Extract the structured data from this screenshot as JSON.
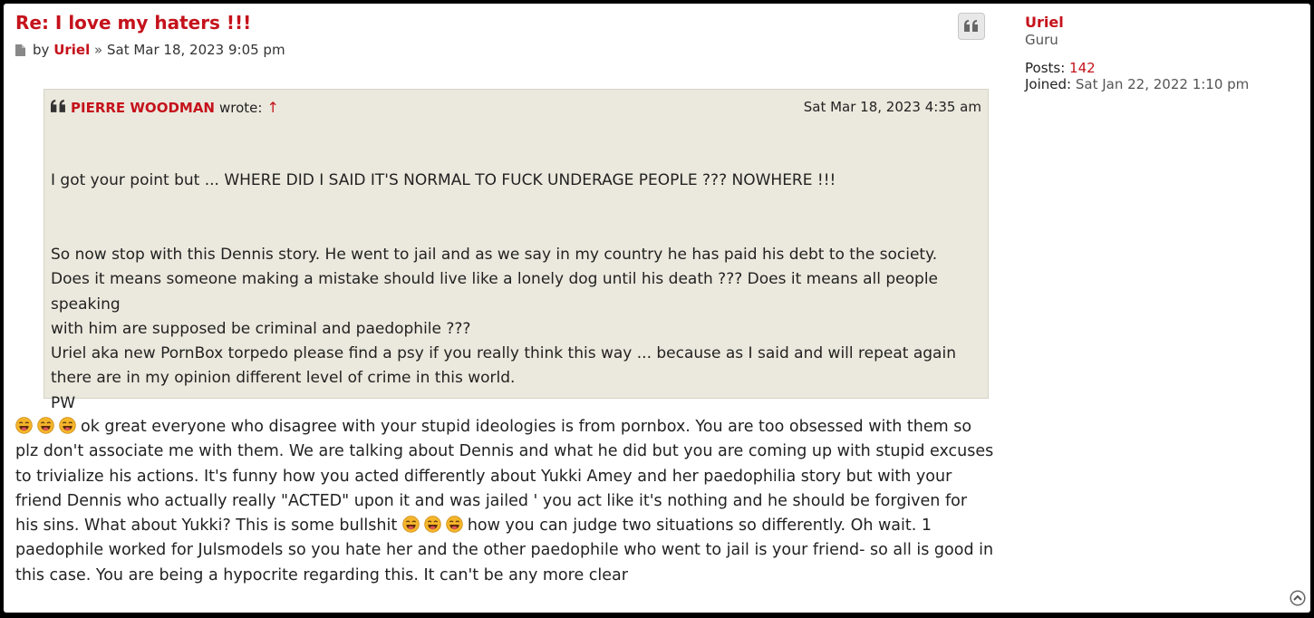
{
  "post": {
    "title": "Re: I love my haters !!!",
    "by_label": "by",
    "author": "Uriel",
    "separator": "»",
    "datetime": "Sat Mar 18, 2023 9:05 pm"
  },
  "quote": {
    "author": "PIERRE WOODMAN",
    "wrote_label": "wrote:",
    "arrow": "↑",
    "date": "Sat Mar 18, 2023 4:35 am",
    "lines": [
      "I got your point but ... WHERE DID I SAID IT'S NORMAL TO FUCK UNDERAGE PEOPLE ??? NOWHERE !!!",
      "So now stop with this Dennis story. He went to jail and as we say in my country he has paid his debt to the society.",
      "Does it means someone making a mistake should live like a lonely dog until his death ??? Does it means all people speaking",
      "with him are supposed be criminal and paedophile ???",
      "Uriel aka new PornBox torpedo please find a psy if you really think this way ... because as I said and will repeat again",
      "there are in my opinion different level of crime in this world.",
      "PW"
    ]
  },
  "body": {
    "part1": "ok great everyone who disagree with your stupid ideologies is from pornbox. You are too obsessed with them so plz don't associate me with them. We are talking about Dennis and what he did but you are coming up with stupid excuses to trivialize his actions. It's funny how you acted differently about Yukki Amey and her paedophilia story but with your friend Dennis who actually really \"ACTED\" upon it and was jailed ' you act like it's nothing and he should be forgiven for his sins. What about Yukki? This is some bullshit",
    "part2": "how you can judge two situations so differently. Oh wait. 1 paedophile worked for Julsmodels so you hate her and the other paedophile who went to jail is your friend- so all is good in this case. You are being a hypocrite regarding this. It can't be any more clear"
  },
  "profile": {
    "name": "Uriel",
    "rank": "Guru",
    "posts_label": "Posts:",
    "posts_value": "142",
    "joined_label": "Joined:",
    "joined_value": "Sat Jan 22, 2022 1:10 pm"
  },
  "icons": {
    "post": "post-icon",
    "quote_button": "quote-icon",
    "emoji": "laughing-tongue-emoji",
    "back_to_top": "chevron-up-circle-icon"
  },
  "colors": {
    "accent": "#c5121b",
    "quote_bg": "#ebe9dd"
  }
}
